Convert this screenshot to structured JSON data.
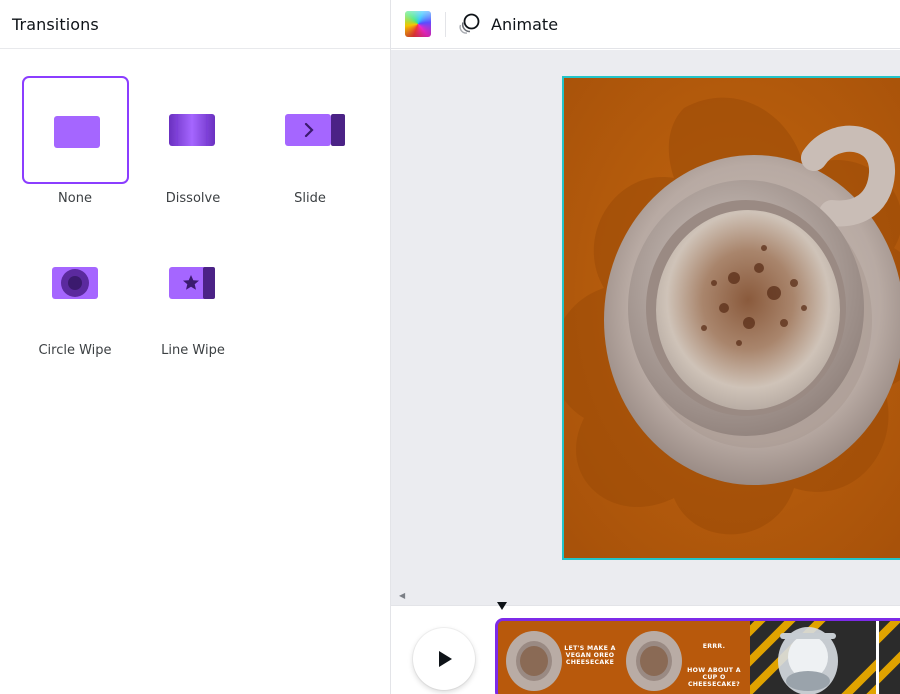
{
  "panel": {
    "title": "Transitions",
    "items": [
      {
        "label": "None",
        "icon": "none-transition-icon",
        "selected": true
      },
      {
        "label": "Dissolve",
        "icon": "dissolve-transition-icon",
        "selected": false
      },
      {
        "label": "Slide",
        "icon": "slide-transition-icon",
        "selected": false
      },
      {
        "label": "Circle Wipe",
        "icon": "circle-wipe-transition-icon",
        "selected": false
      },
      {
        "label": "Line Wipe",
        "icon": "line-wipe-transition-icon",
        "selected": false
      }
    ]
  },
  "toolbar": {
    "color_icon": "color-picker-icon",
    "animate_label": "Animate",
    "animate_icon": "animate-icon"
  },
  "timeline": {
    "play_icon": "play-icon",
    "frame1_text": "LET'S MAKE A VEGAN OREO CHEESECAKE",
    "frame2_text_a": "ERRR.",
    "frame2_text_b": "HOW ABOUT A CUP O CHEESECAKE?"
  },
  "colors": {
    "accent": "#8b3dff",
    "transition_icon": "#a566ff",
    "transition_icon_dark": "#5b2a9e",
    "artboard_border": "#23c4c8",
    "artboard_bg": "#b8590c"
  }
}
